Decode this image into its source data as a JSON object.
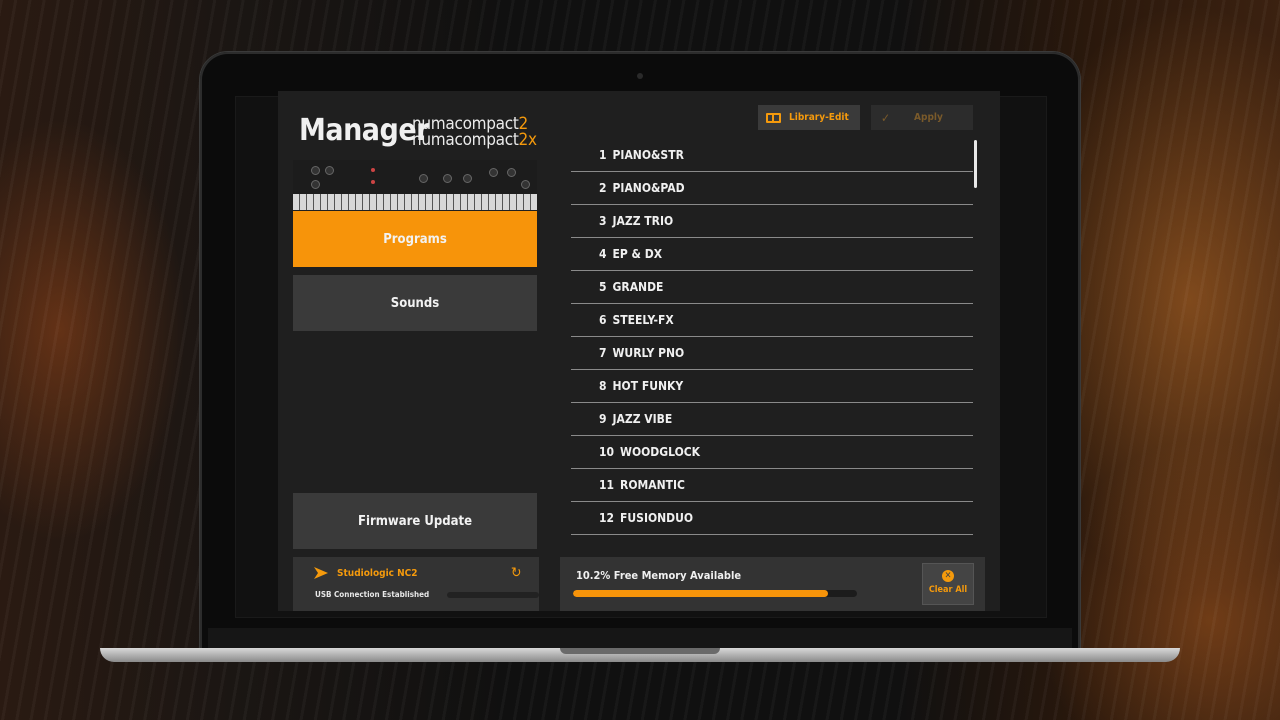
{
  "app": {
    "title": "Manager",
    "model_line1_prefix": "numa",
    "model_line1_bold": "compact",
    "model_line1_num": "2",
    "model_line2_prefix": "numa",
    "model_line2_bold": "compact",
    "model_line2_num": "2x"
  },
  "nav": {
    "programs_label": "Programs",
    "sounds_label": "Sounds",
    "firmware_label": "Firmware Update"
  },
  "toolbar": {
    "library_label": "Library-Edit",
    "apply_label": "Apply"
  },
  "programs": [
    {
      "num": "1",
      "name": "PIANO&STR"
    },
    {
      "num": "2",
      "name": "PIANO&PAD"
    },
    {
      "num": "3",
      "name": "JAZZ TRIO"
    },
    {
      "num": "4",
      "name": "EP & DX"
    },
    {
      "num": "5",
      "name": "GRANDE"
    },
    {
      "num": "6",
      "name": "STEELY-FX"
    },
    {
      "num": "7",
      "name": "WURLY PNO"
    },
    {
      "num": "8",
      "name": "HOT FUNKY"
    },
    {
      "num": "9",
      "name": "JAZZ VIBE"
    },
    {
      "num": "10",
      "name": "WOODGLOCK"
    },
    {
      "num": "11",
      "name": "ROMANTIC"
    },
    {
      "num": "12",
      "name": "FUSIONDUO"
    }
  ],
  "status": {
    "device_name": "Studiologic NC2",
    "connection_text": "USB Connection Established"
  },
  "memory": {
    "text": "10.2% Free Memory Available",
    "used_fraction": 0.898,
    "clear_label": "Clear All"
  },
  "colors": {
    "accent": "#f7940a",
    "panel": "#1f1f1f",
    "button": "#3a3a3a"
  }
}
